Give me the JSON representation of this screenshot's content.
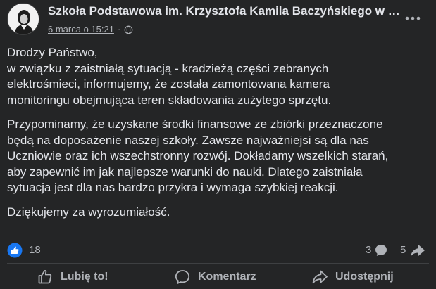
{
  "header": {
    "page_name": "Szkoła Podstawowa im. Krzysztofa Kamila Baczyńskiego w Kosz...",
    "timestamp": "6 marca o 15:21",
    "separator": "·"
  },
  "post": {
    "paragraphs": [
      {
        "lines": [
          "Drodzy Państwo,",
          "w związku z zaistniałą sytuacją - kradzieżą części zebranych",
          "elektrośmieci, informujemy, że została zamontowana kamera",
          "monitoringu obejmująca teren składowania zużytego sprzętu."
        ]
      },
      {
        "lines": [
          "Przypominamy, że uzyskane środki finansowe ze zbiórki przeznaczone",
          "będą na doposażenie naszej szkoły. Zawsze najważniejsi są dla nas",
          "Uczniowie oraz ich wszechstronny rozwój. Dokładamy wszelkich starań,",
          "aby zapewnić im jak najlepsze warunki do nauki. Dlatego zaistniała",
          "sytuacja jest dla nas bardzo przykra i wymaga szybkiej reakcji."
        ]
      },
      {
        "lines": [
          "Dziękujemy za wyrozumiałość."
        ]
      }
    ]
  },
  "stats": {
    "likes": "18",
    "comments": "3",
    "shares": "5"
  },
  "actions": {
    "like_label": "Lubię to!",
    "comment_label": "Komentarz",
    "share_label": "Udostępnij"
  },
  "icons": {
    "avatar": "school-crest-avatar",
    "privacy": "globe-icon",
    "more": "more-dots-icon",
    "like_badge": "like-badge-icon",
    "comment": "comment-bubble-icon",
    "share": "share-arrow-icon"
  },
  "colors": {
    "background": "#242526",
    "text_primary": "#e4e6eb",
    "text_secondary": "#b0b3b8",
    "like_blue": "#1877f2",
    "divider": "#3e4042"
  }
}
